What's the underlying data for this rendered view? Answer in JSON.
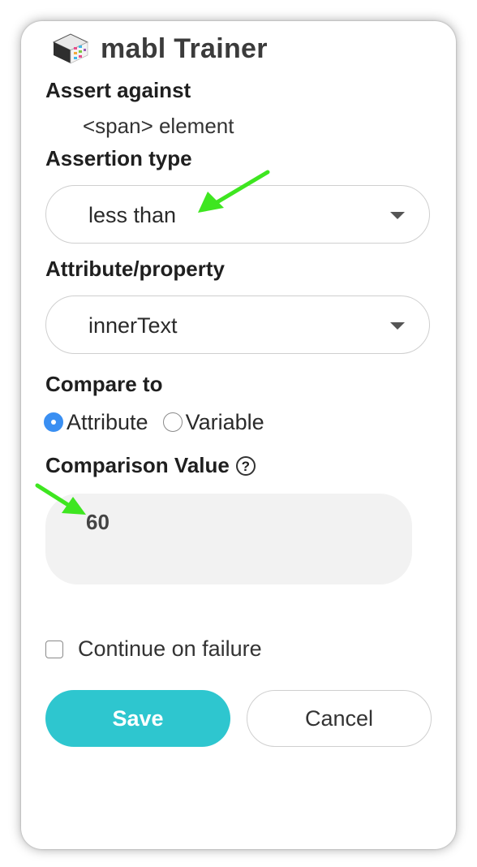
{
  "app": {
    "title": "mabl Trainer"
  },
  "assert_against": {
    "label": "Assert against",
    "element": "<span> element"
  },
  "assertion_type": {
    "label": "Assertion type",
    "selected": "less than"
  },
  "attribute": {
    "label": "Attribute/property",
    "selected": "innerText"
  },
  "compare_to": {
    "label": "Compare to",
    "options": [
      {
        "label": "Attribute",
        "checked": true
      },
      {
        "label": "Variable",
        "checked": false
      }
    ]
  },
  "comparison_value": {
    "label": "Comparison Value",
    "help_icon": "?",
    "value": "60"
  },
  "continue_on_failure": {
    "label": "Continue on failure",
    "checked": false
  },
  "buttons": {
    "save": "Save",
    "cancel": "Cancel"
  },
  "colors": {
    "accent": "#2ec6cf",
    "radio_selected": "#3a8ff2",
    "annotation_arrow": "#3ee620"
  },
  "icons": [
    "mabl-logo-icon",
    "help-circle-icon",
    "chevron-down-icon",
    "annotation-arrow"
  ]
}
